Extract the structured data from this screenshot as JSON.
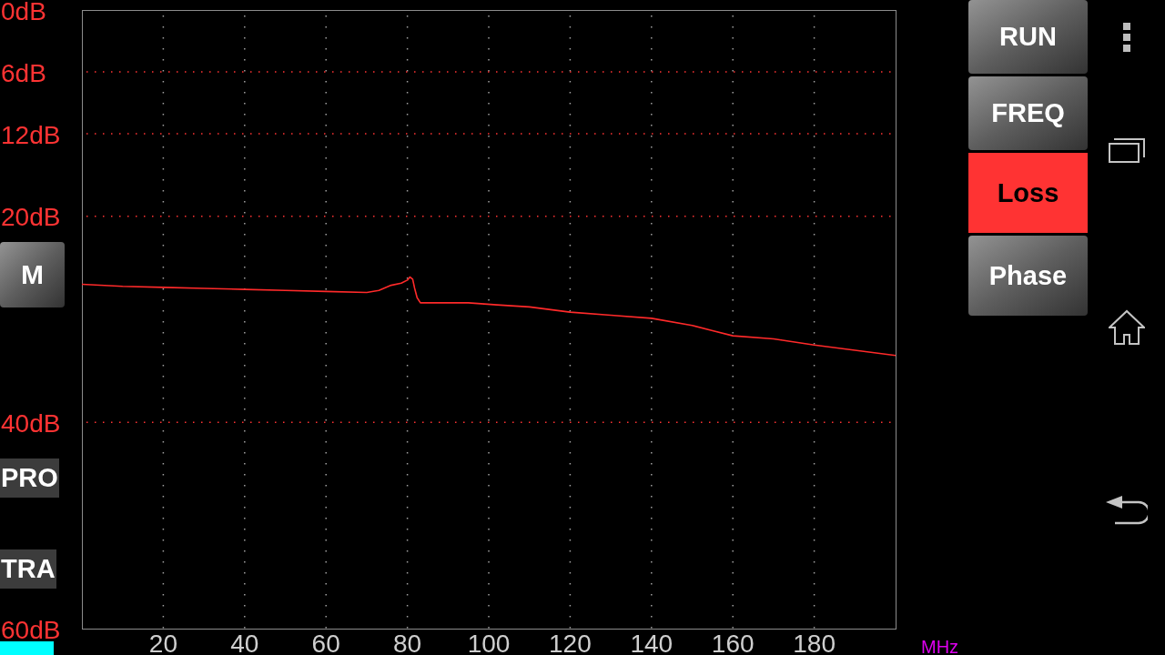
{
  "chart": {
    "chart_data": {
      "type": "line",
      "xlabel": "MHz",
      "x": [
        0,
        10,
        20,
        30,
        40,
        50,
        60,
        70,
        73,
        76,
        78.5,
        80,
        80.6,
        81.3,
        81.8,
        82.4,
        83.2,
        87,
        95,
        102,
        110,
        120,
        130,
        140,
        150,
        155,
        160,
        170,
        180,
        190,
        200
      ],
      "series": [
        {
          "color": "#ff2a2a",
          "values": [
            26.6,
            26.8,
            26.9,
            27.0,
            27.1,
            27.2,
            27.3,
            27.4,
            27.2,
            26.7,
            26.5,
            26.2,
            25.9,
            26.1,
            27.0,
            27.9,
            28.4,
            28.4,
            28.4,
            28.6,
            28.8,
            29.3,
            29.6,
            29.9,
            30.6,
            31.1,
            31.6,
            31.9,
            32.5,
            33.0,
            33.5
          ]
        }
      ],
      "xlim": [
        0,
        200
      ],
      "ylim": [
        60,
        0
      ],
      "xticks": [
        20,
        40,
        60,
        80,
        100,
        120,
        140,
        160,
        180
      ],
      "yticks": [
        {
          "value": 0,
          "label": "0dB"
        },
        {
          "value": 6,
          "label": "6dB"
        },
        {
          "value": 12,
          "label": "12dB"
        },
        {
          "value": 20,
          "label": "20dB"
        },
        {
          "value": 40,
          "label": "40dB"
        },
        {
          "value": 60,
          "label": "60dB"
        }
      ],
      "grid": true
    }
  },
  "m_button": {
    "label": "M"
  },
  "mode_toggles": [
    {
      "label": "PRO"
    },
    {
      "label": "TRA"
    }
  ],
  "action_buttons": [
    {
      "label": "RUN"
    },
    {
      "label": "FREQ"
    }
  ],
  "mode_tabs": [
    {
      "label": "Loss",
      "selected": true
    },
    {
      "label": "Phase",
      "selected": false
    }
  ]
}
